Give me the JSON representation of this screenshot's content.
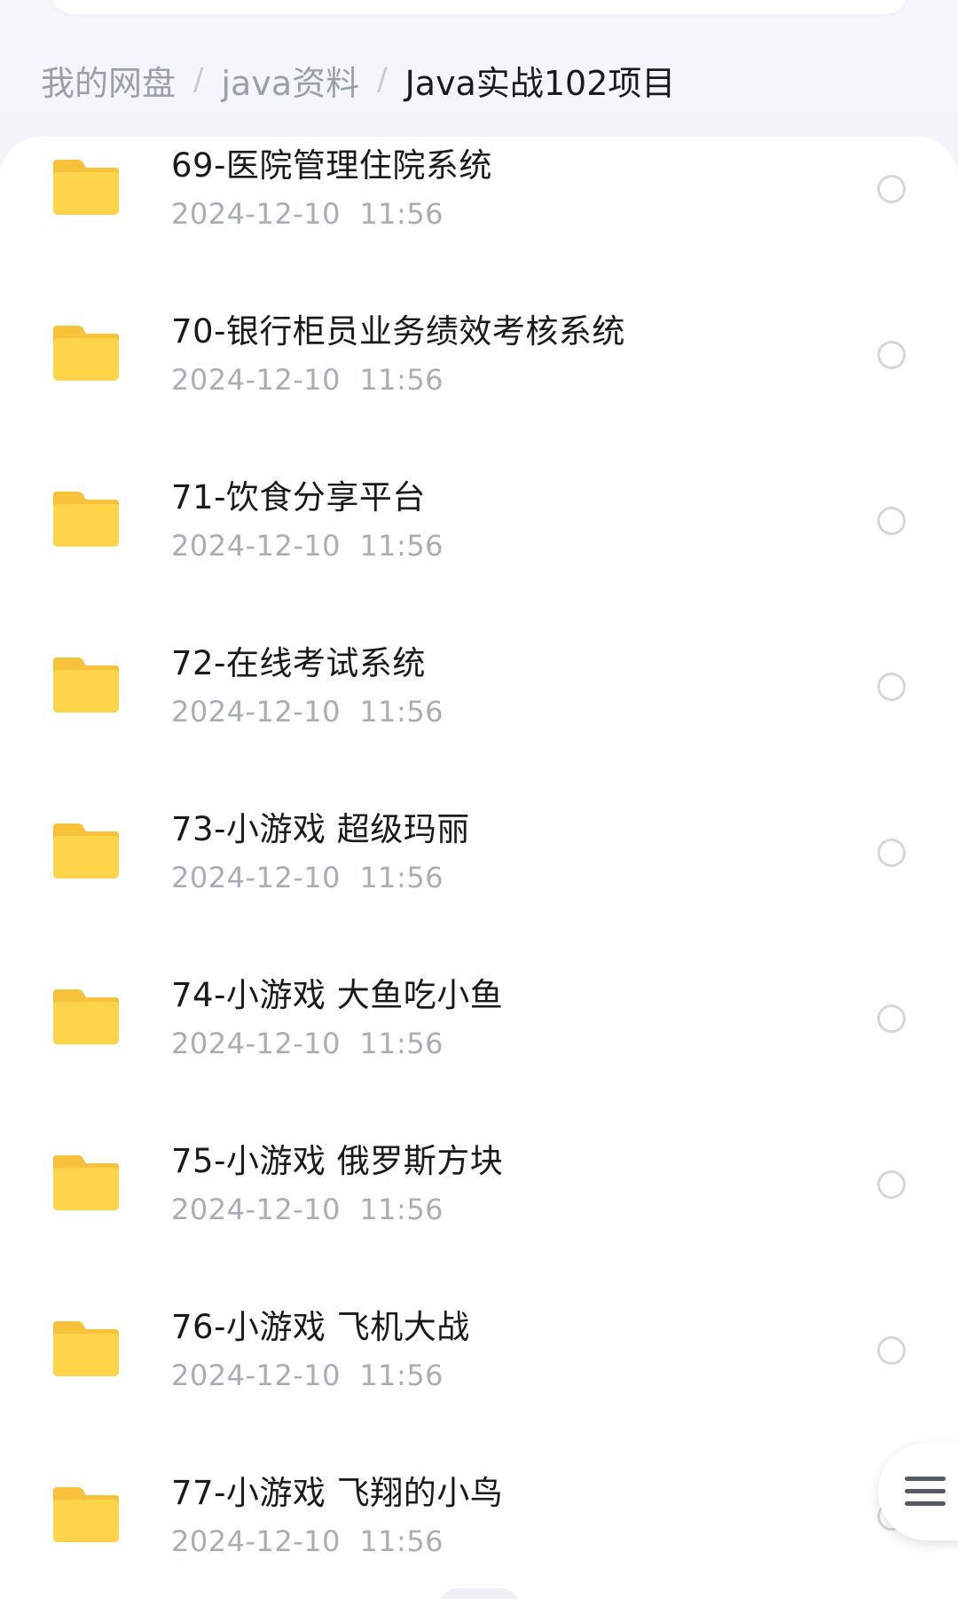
{
  "breadcrumb": {
    "items": [
      "我的网盘",
      "java资料",
      "Java实战102项目"
    ],
    "separator": "/"
  },
  "files": [
    {
      "name": "69-医院管理住院系统",
      "date": "2024-12-10  11:56"
    },
    {
      "name": "70-银行柜员业务绩效考核系统",
      "date": "2024-12-10  11:56"
    },
    {
      "name": "71-饮食分享平台",
      "date": "2024-12-10  11:56"
    },
    {
      "name": "72-在线考试系统",
      "date": "2024-12-10  11:56"
    },
    {
      "name": "73-小游戏 超级玛丽",
      "date": "2024-12-10  11:56"
    },
    {
      "name": "74-小游戏 大鱼吃小鱼",
      "date": "2024-12-10  11:56"
    },
    {
      "name": "75-小游戏 俄罗斯方块",
      "date": "2024-12-10  11:56"
    },
    {
      "name": "76-小游戏 飞机大战",
      "date": "2024-12-10  11:56"
    },
    {
      "name": "77-小游戏 飞翔的小鸟",
      "date": "2024-12-10  11:56"
    }
  ],
  "icons": {
    "row_icon": "folder-icon",
    "row_select": "select-circle",
    "fab": "menu-icon"
  },
  "colors": {
    "folder_front": "#fdd44a",
    "folder_back": "#f7c23a",
    "text_primary": "#1a1a1a",
    "text_secondary": "#a9adb5",
    "background": "#f3f5fa"
  }
}
